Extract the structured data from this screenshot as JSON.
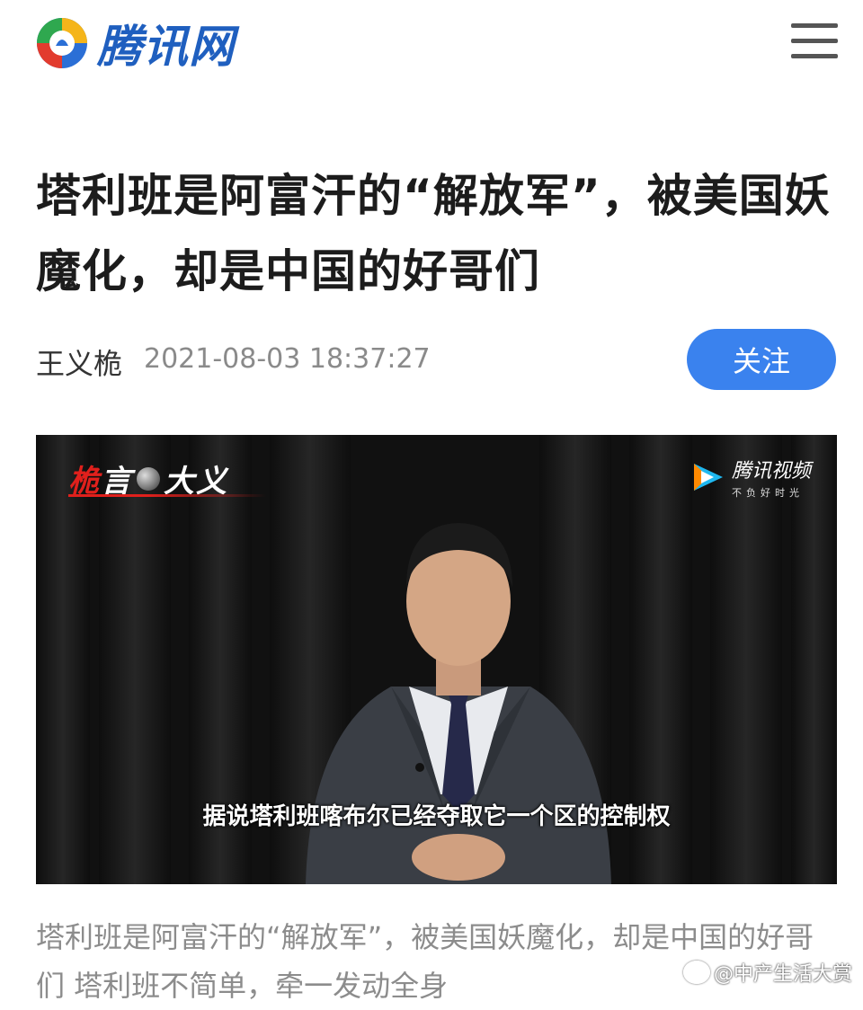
{
  "header": {
    "logo_text": "腾讯网",
    "menu_icon": "hamburger-menu-icon"
  },
  "article": {
    "title": "塔利班是阿富汗的“解放军”，被美国妖魔化，却是中国的好哥们",
    "author": "王义桅",
    "timestamp": "2021-08-03 18:37:27",
    "follow_label": "关注",
    "summary": "塔利班是阿富汗的“解放军”，被美国妖魔化，却是中国的好哥们 塔利班不简单，牵一发动全身"
  },
  "video": {
    "show_logo_red": "桅",
    "show_logo_white_1": "言",
    "show_logo_white_2": "大义",
    "platform_name": "腾讯视频",
    "platform_slogan": "不负好时光",
    "subtitle": "据说塔利班喀布尔已经夺取它一个区的控制权"
  },
  "watermark": {
    "text": "@中产生活大赏"
  },
  "colors": {
    "brand_blue": "#1f5fbf",
    "follow_button": "#3a82ee",
    "show_red": "#e0201c",
    "summary_gray": "#8c8c8c"
  }
}
